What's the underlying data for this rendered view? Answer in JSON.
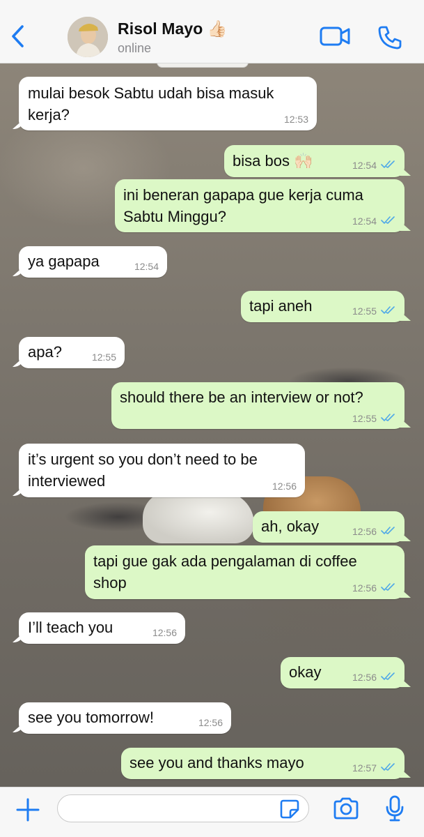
{
  "header": {
    "contact_name": "Risol Mayo 👍🏻",
    "status": "online"
  },
  "colors": {
    "accent": "#1e7cf2",
    "outgoing_bubble": "#dcf8c6",
    "incoming_bubble": "#ffffff",
    "read_ticks": "#4fa8e8"
  },
  "icons": [
    "back-chevron-icon",
    "video-camera-icon",
    "phone-icon",
    "plus-icon",
    "sticker-icon",
    "camera-icon",
    "microphone-icon",
    "double-check-icon"
  ],
  "messages": [
    {
      "direction": "in",
      "lines": [
        "mulai besok Sabtu udah bisa masuk",
        "kerja?"
      ],
      "time": "12:53"
    },
    {
      "direction": "out",
      "lines": [
        "bisa bos 🙌🏻"
      ],
      "time": "12:54",
      "read": true
    },
    {
      "direction": "out",
      "lines": [
        "ini beneran gapapa gue kerja cuma",
        "Sabtu Minggu?"
      ],
      "time": "12:54",
      "read": true
    },
    {
      "direction": "in",
      "lines": [
        "ya gapapa"
      ],
      "time": "12:54"
    },
    {
      "direction": "out",
      "lines": [
        "tapi aneh"
      ],
      "time": "12:55",
      "read": true
    },
    {
      "direction": "in",
      "lines": [
        "apa?"
      ],
      "time": "12:55"
    },
    {
      "direction": "out",
      "lines": [
        "should there be an interview or not?"
      ],
      "time": "12:55",
      "read": true
    },
    {
      "direction": "in",
      "lines": [
        "it’s urgent so you don’t need to be",
        "interviewed"
      ],
      "time": "12:56"
    },
    {
      "direction": "out",
      "lines": [
        "ah, okay"
      ],
      "time": "12:56",
      "read": true
    },
    {
      "direction": "out",
      "lines": [
        "tapi gue gak ada pengalaman di coffee",
        "shop"
      ],
      "time": "12:56",
      "read": true
    },
    {
      "direction": "in",
      "lines": [
        "I’ll teach you"
      ],
      "time": "12:56"
    },
    {
      "direction": "out",
      "lines": [
        "okay"
      ],
      "time": "12:56",
      "read": true
    },
    {
      "direction": "in",
      "lines": [
        "see you tomorrow!"
      ],
      "time": "12:56"
    },
    {
      "direction": "out",
      "lines": [
        "see you and thanks mayo"
      ],
      "time": "12:57",
      "read": true
    }
  ],
  "composer": {
    "value": "",
    "placeholder": ""
  }
}
